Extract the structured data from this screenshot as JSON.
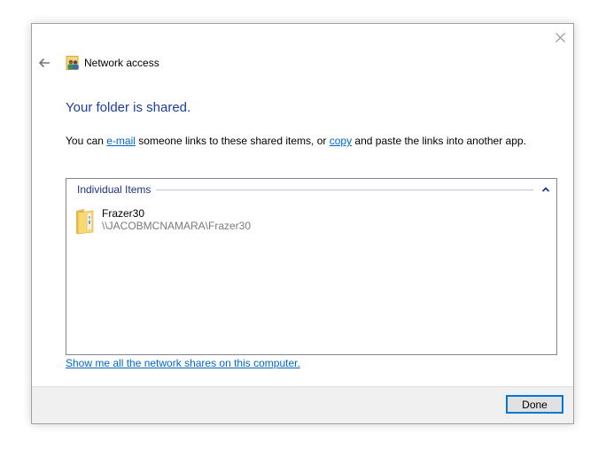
{
  "window": {
    "title": "Network access",
    "title_icon": "network-users-icon",
    "close_icon": "close-icon",
    "back_icon": "back-arrow-icon"
  },
  "main": {
    "heading": "Your folder is shared.",
    "description": {
      "part1": "You can ",
      "email_link": "e-mail",
      "part2": " someone links to these shared items, or ",
      "copy_link": "copy",
      "part3": " and paste the links into another app."
    },
    "group": {
      "label": "Individual Items",
      "collapse_icon": "chevron-up-icon",
      "items": [
        {
          "name": "Frazer30",
          "path": "\\\\JACOBMCNAMARA\\Frazer30",
          "icon": "folder-icon"
        }
      ]
    },
    "shares_link": "Show me all the network shares on this computer."
  },
  "footer": {
    "done_label": "Done"
  },
  "colors": {
    "heading": "#1c3fa0",
    "link": "#0066cc",
    "group_label": "#1e3287",
    "path_text": "#7a7a7a",
    "focus_border": "#0078d7",
    "footer_bg": "#f0f0f0"
  }
}
